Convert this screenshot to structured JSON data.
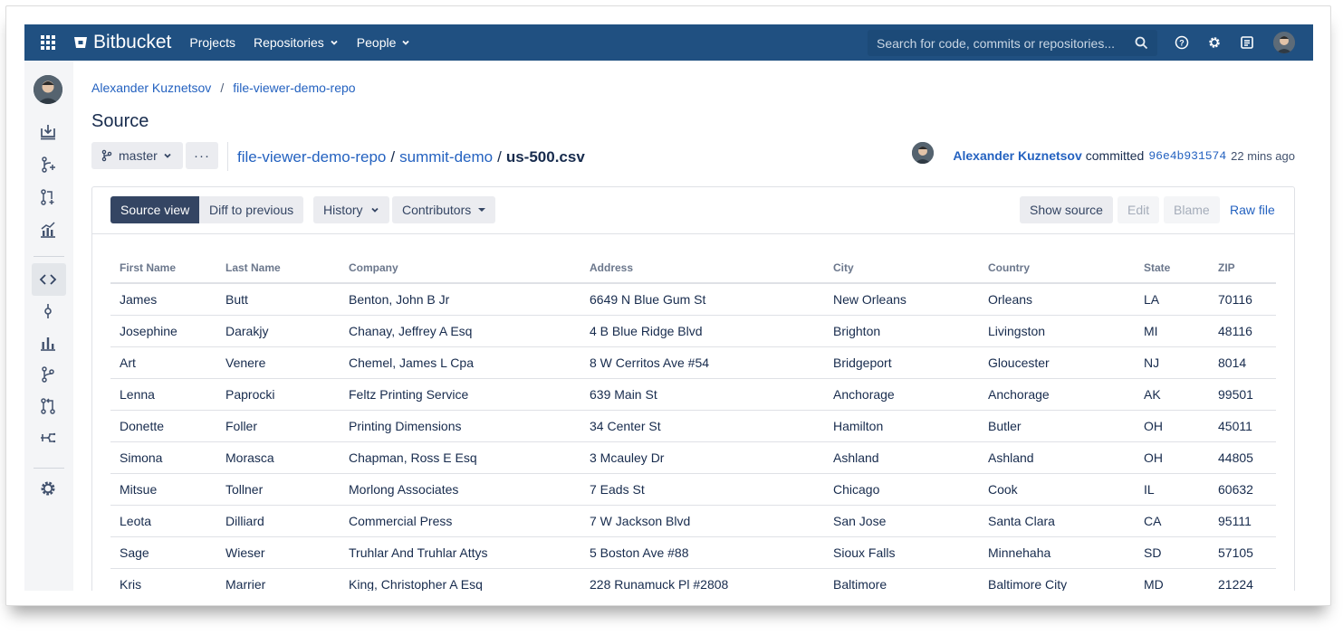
{
  "topnav": {
    "brand": "Bitbucket",
    "items": [
      {
        "label": "Projects",
        "has_menu": false
      },
      {
        "label": "Repositories",
        "has_menu": true
      },
      {
        "label": "People",
        "has_menu": true
      }
    ],
    "search_placeholder": "Search for code, commits or repositories...",
    "icons": [
      "help-icon",
      "settings-icon",
      "inbox-icon",
      "user-avatar"
    ],
    "bg_color": "#205081"
  },
  "sidebar": {
    "icons": [
      "clone-icon",
      "create-branch-icon",
      "create-pull-request-icon",
      "insights-icon",
      "source-icon",
      "commits-icon",
      "graph-icon",
      "branches-icon",
      "pull-requests-icon",
      "forks-icon",
      "repository-settings-icon"
    ],
    "active": "source-icon"
  },
  "breadcrumb": {
    "owner": "Alexander Kuznetsov",
    "separator": "/",
    "repo": "file-viewer-demo-repo"
  },
  "page": {
    "title": "Source"
  },
  "branch": {
    "name": "master",
    "more_label": "···"
  },
  "filepath": {
    "repo": "file-viewer-demo-repo",
    "folder": "summit-demo",
    "file": "us-500.csv",
    "slash": "/"
  },
  "commit": {
    "author": "Alexander Kuznetsov",
    "verb": "committed",
    "hash": "96e4b931574",
    "ago": "22 mins ago"
  },
  "toolbar": {
    "source_view": "Source view",
    "diff": "Diff to previous",
    "history": "History",
    "contributors": "Contributors",
    "show_source": "Show source",
    "edit": "Edit",
    "blame": "Blame",
    "raw_file": "Raw file"
  },
  "table": {
    "headers": [
      "First Name",
      "Last Name",
      "Company",
      "Address",
      "City",
      "Country",
      "State",
      "ZIP"
    ],
    "rows": [
      [
        "James",
        "Butt",
        "Benton, John B Jr",
        "6649 N Blue Gum St",
        "New Orleans",
        "Orleans",
        "LA",
        "70116"
      ],
      [
        "Josephine",
        "Darakjy",
        "Chanay, Jeffrey A Esq",
        "4 B Blue Ridge Blvd",
        "Brighton",
        "Livingston",
        "MI",
        "48116"
      ],
      [
        "Art",
        "Venere",
        "Chemel, James L Cpa",
        "8 W Cerritos Ave #54",
        "Bridgeport",
        "Gloucester",
        "NJ",
        "8014"
      ],
      [
        "Lenna",
        "Paprocki",
        "Feltz Printing Service",
        "639 Main St",
        "Anchorage",
        "Anchorage",
        "AK",
        "99501"
      ],
      [
        "Donette",
        "Foller",
        "Printing Dimensions",
        "34 Center St",
        "Hamilton",
        "Butler",
        "OH",
        "45011"
      ],
      [
        "Simona",
        "Morasca",
        "Chapman, Ross E Esq",
        "3 Mcauley Dr",
        "Ashland",
        "Ashland",
        "OH",
        "44805"
      ],
      [
        "Mitsue",
        "Tollner",
        "Morlong Associates",
        "7 Eads St",
        "Chicago",
        "Cook",
        "IL",
        "60632"
      ],
      [
        "Leota",
        "Dilliard",
        "Commercial Press",
        "7 W Jackson Blvd",
        "San Jose",
        "Santa Clara",
        "CA",
        "95111"
      ],
      [
        "Sage",
        "Wieser",
        "Truhlar And Truhlar Attys",
        "5 Boston Ave #88",
        "Sioux Falls",
        "Minnehaha",
        "SD",
        "57105"
      ],
      [
        "Kris",
        "Marrier",
        "King, Christopher A Esq",
        "228 Runamuck Pl #2808",
        "Baltimore",
        "Baltimore City",
        "MD",
        "21224"
      ]
    ]
  }
}
